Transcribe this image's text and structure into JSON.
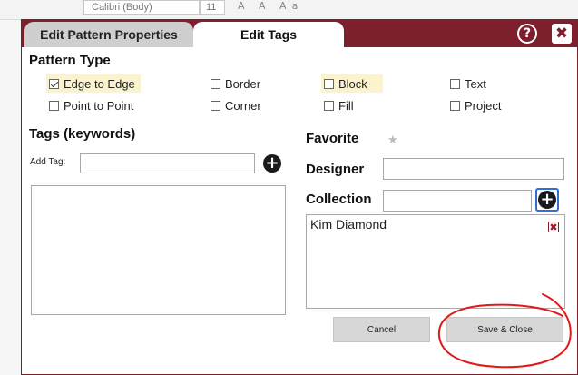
{
  "background_app": {
    "font_name": "Calibri (Body)",
    "font_size": "11",
    "toolbar_glyphs": "A A Aa"
  },
  "dialog": {
    "tabs": [
      {
        "label": "Edit Pattern Properties",
        "active": false
      },
      {
        "label": "Edit Tags",
        "active": true
      }
    ],
    "help_icon": "question-circle-icon",
    "close_icon": "close-x-icon",
    "help_glyph": "?",
    "close_glyph": "✖",
    "colors": {
      "titlebar": "#7e1f2e",
      "inactive_tab": "#cfcfcf",
      "highlight": "#fbf3cd",
      "focus_border": "#2f6fd6",
      "annotation": "#e01919"
    }
  },
  "pattern_type": {
    "title": "Pattern Type",
    "options": [
      {
        "label": "Edge to Edge",
        "checked": true,
        "highlighted": true
      },
      {
        "label": "Border",
        "checked": false,
        "highlighted": false
      },
      {
        "label": "Block",
        "checked": false,
        "highlighted": true
      },
      {
        "label": "Text",
        "checked": false,
        "highlighted": false
      },
      {
        "label": "Point to Point",
        "checked": false,
        "highlighted": false
      },
      {
        "label": "Corner",
        "checked": false,
        "highlighted": false
      },
      {
        "label": "Fill",
        "checked": false,
        "highlighted": false
      },
      {
        "label": "Project",
        "checked": false,
        "highlighted": false
      }
    ]
  },
  "tags": {
    "title": "Tags (keywords)",
    "add_tag_label": "Add Tag:",
    "add_tag_value": "",
    "add_icon": "plus-circle-icon",
    "add_glyph": "+"
  },
  "favorite": {
    "label": "Favorite",
    "icon": "star-icon",
    "glyph": "★"
  },
  "designer": {
    "label": "Designer",
    "value": ""
  },
  "collection": {
    "label": "Collection",
    "value": "",
    "add_glyph": "+",
    "items": [
      {
        "name": "Kim Diamond",
        "remove_glyph": "✖"
      }
    ]
  },
  "buttons": {
    "cancel": "Cancel",
    "save_close": "Save & Close"
  }
}
